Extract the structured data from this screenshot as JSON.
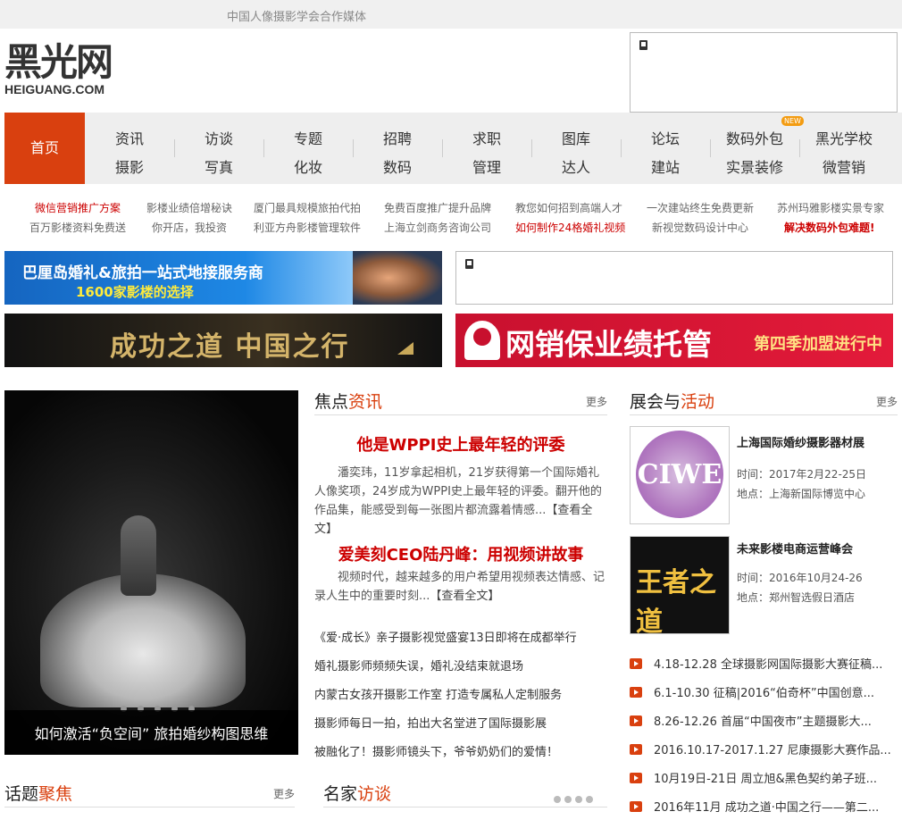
{
  "topbar": {
    "text": "中国人像摄影学会合作媒体"
  },
  "logo": {
    "main": "黑光网",
    "sub": "HEIGUANG.COM"
  },
  "nav": {
    "home": "首页",
    "cols": [
      {
        "top": "资讯",
        "bottom": "摄影"
      },
      {
        "top": "访谈",
        "bottom": "写真"
      },
      {
        "top": "专题",
        "bottom": "化妆"
      },
      {
        "top": "招聘",
        "bottom": "数码"
      },
      {
        "top": "求职",
        "bottom": "管理"
      },
      {
        "top": "图库",
        "bottom": "达人"
      },
      {
        "top": "论坛",
        "bottom": "建站"
      },
      {
        "top": "数码外包",
        "bottom": "实景装修"
      },
      {
        "top": "黑光学校",
        "bottom": "微营销"
      }
    ],
    "badge": "NEW"
  },
  "links": {
    "row1": [
      "微信营销推广方案",
      "影楼业绩倍增秘诀",
      "厦门最具规模旅拍代拍",
      "免费百度推广提升品牌",
      "教您如何招到高端人才",
      "一次建站终生免费更新",
      "苏州玛雅影楼实景专家"
    ],
    "row2": [
      "百万影楼资料免费送",
      "你开店，我投资",
      "利亚方舟影楼管理软件",
      "上海立剑商务咨询公司",
      "如何制作24格婚礼视频",
      "新视觉数码设计中心",
      "解决数码外包难题!"
    ]
  },
  "banners": {
    "b1_line1": "巴厘岛婚礼&旅拍一站式地接服务商",
    "b1_line2": "1600家影楼的选择",
    "b2": "成功之道 中国之行",
    "b3_main": "网销保业绩托管",
    "b3_sub": "第四季加盟进行中"
  },
  "slide": {
    "caption": "如何激活“负空间” 旅拍婚纱构图思维"
  },
  "focus": {
    "title_plain": "焦点",
    "title_red": "资讯",
    "more": "更多",
    "items": [
      {
        "title": "他是WPPI史上最年轻的评委",
        "desc": "潘奕玮，11岁拿起相机，21岁获得第一个国际婚礼人像奖项，24岁成为WPPI史上最年轻的评委。翻开他的作品集，能感受到每一张图片都流露着情感...",
        "link": "【查看全文】"
      },
      {
        "title": "爱美刻CEO陆丹峰：用视频讲故事",
        "desc": "视频时代，越来越多的用户希望用视频表达情感、记录人生中的重要时刻...",
        "link": "【查看全文】"
      }
    ],
    "list": [
      "《爱·成长》亲子摄影视觉盛宴13日即将在成都举行",
      "婚礼摄影师频频失误，婚礼没结束就退场",
      "内蒙古女孩开摄影工作室 打造专属私人定制服务",
      "摄影师每日一拍，拍出大名堂进了国际摄影展",
      "被融化了！摄影师镜头下，爷爷奶奶们的爱情！"
    ]
  },
  "events": {
    "title_plain": "展会与",
    "title_red": "活动",
    "more": "更多",
    "items": [
      {
        "img_text": "CIWE",
        "name": "上海国际婚纱摄影器材展",
        "time": "时间：2017年2月22-25日",
        "place": "地点：上海新国际博览中心"
      },
      {
        "img_text": "王者之道",
        "name": "未来影楼电商运营峰会",
        "time": "时间：2016年10月24-26",
        "place": "地点：郑州智选假日酒店"
      }
    ],
    "list": [
      "4.18-12.28 全球摄影网国际摄影大赛征稿...",
      "6.1-10.30 征稿|2016“伯奇杯”中国创意...",
      "8.26-12.26 首届“中国夜市”主题摄影大...",
      "2016.10.17-2017.1.27 尼康摄影大赛作品...",
      "10月19日-21日 周立旭&黑色契约弟子班...",
      "2016年11月 成功之道·中国之行——第二..."
    ]
  },
  "topics": {
    "title_plain": "话题",
    "title_red": "聚焦",
    "more": "更多"
  },
  "interviews": {
    "title_plain": "名家",
    "title_red": "访谈"
  }
}
